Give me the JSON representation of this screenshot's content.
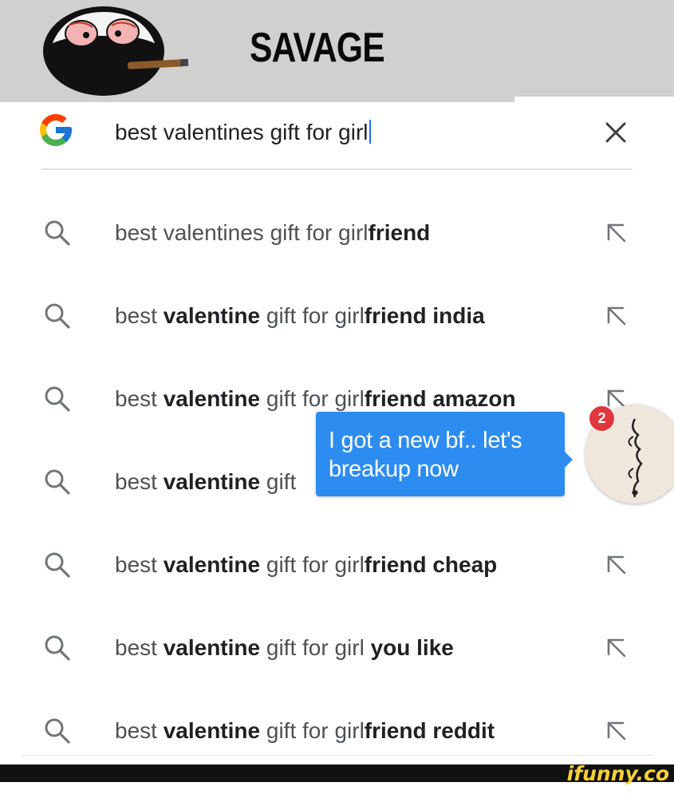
{
  "header": {
    "caption": "SAVAGE"
  },
  "search": {
    "query": "best valentines gift for girl"
  },
  "suggestions": [
    {
      "parts": [
        {
          "t": "best valentines gift for girl",
          "b": false
        },
        {
          "t": "friend",
          "b": true
        }
      ]
    },
    {
      "parts": [
        {
          "t": "best ",
          "b": false
        },
        {
          "t": "valentine",
          "b": true
        },
        {
          "t": " gift for girl",
          "b": false
        },
        {
          "t": "friend india",
          "b": true
        }
      ]
    },
    {
      "parts": [
        {
          "t": "best ",
          "b": false
        },
        {
          "t": "valentine",
          "b": true
        },
        {
          "t": " gift for girl",
          "b": false
        },
        {
          "t": "friend amazon",
          "b": true
        }
      ]
    },
    {
      "parts": [
        {
          "t": "best ",
          "b": false
        },
        {
          "t": "valentine",
          "b": true
        },
        {
          "t": " gift",
          "b": false
        }
      ]
    },
    {
      "parts": [
        {
          "t": "best ",
          "b": false
        },
        {
          "t": "valentine",
          "b": true
        },
        {
          "t": " gift for girl",
          "b": false
        },
        {
          "t": "friend cheap",
          "b": true
        }
      ]
    },
    {
      "parts": [
        {
          "t": "best ",
          "b": false
        },
        {
          "t": "valentine",
          "b": true
        },
        {
          "t": " gift for girl ",
          "b": false
        },
        {
          "t": "you like",
          "b": true
        }
      ]
    },
    {
      "parts": [
        {
          "t": "best ",
          "b": false
        },
        {
          "t": "valentine",
          "b": true
        },
        {
          "t": " gift for girl",
          "b": false
        },
        {
          "t": "friend reddit",
          "b": true
        }
      ]
    }
  ],
  "chat": {
    "message_line1": "I got a new bf.. let's",
    "message_line2": "breakup now",
    "unread_count": "2"
  },
  "watermark": "ifunny.co",
  "icons": {
    "search": "search-icon",
    "fill": "arrow-up-left-icon",
    "clear": "close-icon",
    "logo": "google-g-logo"
  },
  "colors": {
    "header_bg": "#d2cfcf",
    "bubble": "#2d8cf0",
    "badge": "#e0373c",
    "watermark": "#f7d038"
  }
}
